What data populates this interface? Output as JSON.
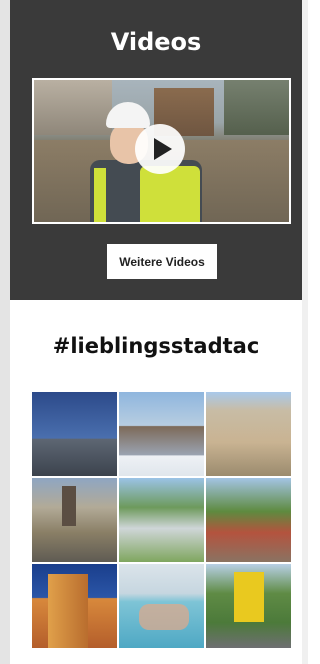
{
  "videos": {
    "title": "Videos",
    "play_icon": "play-icon",
    "more_button_label": "Weitere Videos"
  },
  "social": {
    "hashtag_title": "#lieblingsstadtac",
    "tiles": [
      {
        "name": "modern-building-photo"
      },
      {
        "name": "cathedral-christmas-market-photo"
      },
      {
        "name": "historic-townhouses-photo"
      },
      {
        "name": "city-gate-autumn-photo"
      },
      {
        "name": "park-fountain-photo"
      },
      {
        "name": "outdoor-cafe-photo"
      },
      {
        "name": "orange-lit-building-photo"
      },
      {
        "name": "children-in-fountain-photo"
      },
      {
        "name": "park-yellow-sign-photo"
      }
    ]
  },
  "colors": {
    "section_dark": "#3a3a3a",
    "text_light": "#ffffff",
    "text_dark": "#111111"
  }
}
